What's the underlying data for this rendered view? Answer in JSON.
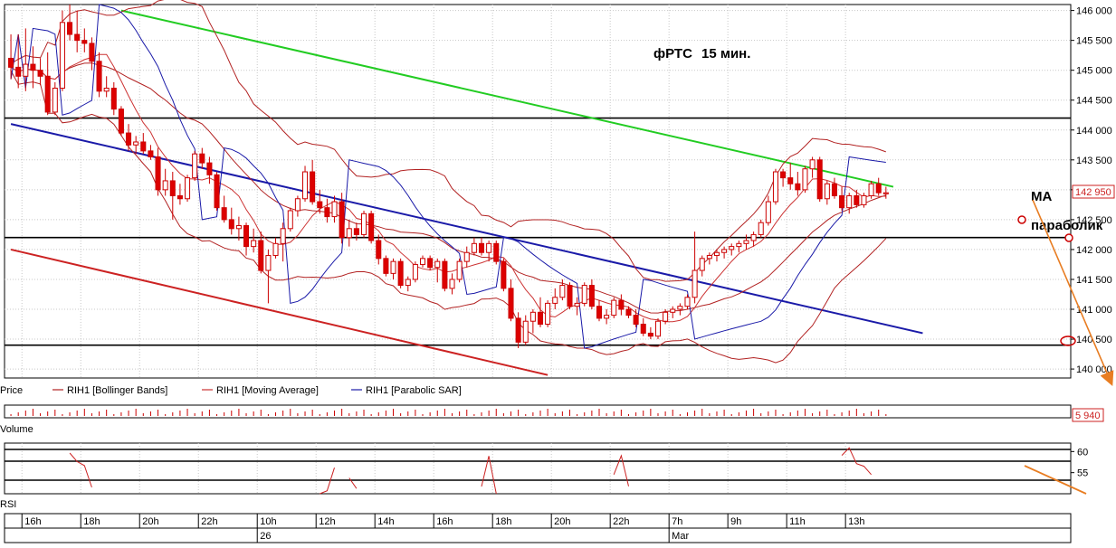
{
  "chart_data": {
    "type": "candlestick",
    "instrument": "RIH1",
    "title": "фРТС",
    "timeframe": "15 мин.",
    "price_axis": {
      "ylim": [
        139850,
        146100
      ],
      "ticks": [
        140000,
        140500,
        141000,
        141500,
        142000,
        142500,
        143000,
        143500,
        144000,
        144500,
        145000,
        145500,
        146000
      ],
      "tick_labels": [
        "140 000",
        "140 500",
        "141 000",
        "141 500",
        "142 000",
        "142 500",
        "143 000",
        "143 500",
        "144 000",
        "144 500",
        "145 000",
        "145 500",
        "146 000"
      ],
      "last_price_label": "142 950"
    },
    "time_axis": {
      "labels": [
        "16h",
        "18h",
        "20h",
        "22h",
        "10h",
        "12h",
        "14h",
        "16h",
        "18h",
        "20h",
        "22h",
        "7h",
        "9h",
        "11h",
        "13h"
      ],
      "label_bar_index": [
        2,
        10,
        18,
        26,
        34,
        42,
        50,
        58,
        66,
        74,
        82,
        90,
        98,
        106,
        114
      ],
      "dates": [
        {
          "label": "26",
          "bar_index": 34
        },
        {
          "label": "Mar",
          "bar_index": 90
        }
      ]
    },
    "legend": [
      "Price",
      "RIH1 [Bollinger Bands]",
      "RIH1 [Moving Average]",
      "RIH1 [Parabolic SAR]"
    ],
    "panels": {
      "volume": {
        "label": "Volume",
        "last_value_label": "5 940"
      },
      "rsi": {
        "label": "RSI",
        "ticks": [
          60,
          55
        ],
        "tick_labels": [
          "60",
          "55"
        ],
        "ylim": [
          50,
          62
        ]
      }
    },
    "horizontal_levels": [
      144200,
      142200,
      140400
    ],
    "trend_lines": [
      {
        "name": "green",
        "color": "#22cc22",
        "points": [
          [
            15,
            146000
          ],
          [
            120,
            143050
          ]
        ]
      },
      {
        "name": "blue",
        "color": "#1a1aa8",
        "points": [
          [
            0,
            144100
          ],
          [
            124,
            140600
          ]
        ]
      },
      {
        "name": "red",
        "color": "#cc2222",
        "points": [
          [
            0,
            142000
          ],
          [
            73,
            139900
          ]
        ]
      }
    ],
    "annotations": {
      "ma": "MA",
      "parabolic": "параболик"
    },
    "bars_ohlc": [
      [
        145200,
        145600,
        144850,
        145050
      ],
      [
        145050,
        145600,
        144700,
        144900
      ],
      [
        144900,
        145700,
        144650,
        145100
      ],
      [
        145100,
        145400,
        144700,
        145000
      ],
      [
        145000,
        145200,
        144750,
        144900
      ],
      [
        144900,
        145300,
        144250,
        144300
      ],
      [
        144300,
        144800,
        144250,
        144700
      ],
      [
        144700,
        146000,
        144650,
        145800
      ],
      [
        145800,
        146100,
        145500,
        145600
      ],
      [
        145600,
        146000,
        145300,
        145500
      ],
      [
        145500,
        145700,
        145300,
        145450
      ],
      [
        145450,
        145550,
        145000,
        145150
      ],
      [
        145150,
        145300,
        144550,
        144650
      ],
      [
        144650,
        144900,
        144550,
        144700
      ],
      [
        144700,
        144800,
        144250,
        144350
      ],
      [
        144350,
        144400,
        143900,
        143950
      ],
      [
        143950,
        144100,
        143650,
        143750
      ],
      [
        143750,
        143900,
        143600,
        143800
      ],
      [
        143800,
        143950,
        143600,
        143650
      ],
      [
        143650,
        143750,
        143500,
        143550
      ],
      [
        143550,
        143700,
        142900,
        143000
      ],
      [
        143000,
        143350,
        142900,
        143150
      ],
      [
        143150,
        143300,
        142500,
        142900
      ],
      [
        142900,
        143100,
        142750,
        142850
      ],
      [
        142850,
        143250,
        142800,
        143200
      ],
      [
        143200,
        143650,
        143150,
        143600
      ],
      [
        143600,
        143700,
        143350,
        143450
      ],
      [
        143450,
        143550,
        143100,
        143250
      ],
      [
        143250,
        143300,
        142650,
        142700
      ],
      [
        142700,
        142900,
        142450,
        142500
      ],
      [
        142500,
        142700,
        142250,
        142350
      ],
      [
        142350,
        142550,
        142150,
        142400
      ],
      [
        142400,
        142450,
        141900,
        142050
      ],
      [
        142050,
        142350,
        141950,
        142150
      ],
      [
        142150,
        142300,
        141600,
        141650
      ],
      [
        141650,
        142000,
        141100,
        141900
      ],
      [
        141900,
        142200,
        141850,
        142100
      ],
      [
        142100,
        142450,
        141800,
        142350
      ],
      [
        142350,
        142700,
        142300,
        142650
      ],
      [
        142650,
        142900,
        142550,
        142850
      ],
      [
        142850,
        143400,
        142800,
        143300
      ],
      [
        143300,
        143500,
        142750,
        142800
      ],
      [
        142800,
        143000,
        142600,
        142700
      ],
      [
        142700,
        142850,
        142450,
        142550
      ],
      [
        142550,
        142900,
        142450,
        142800
      ],
      [
        142800,
        142950,
        142100,
        142200
      ],
      [
        142200,
        142500,
        142050,
        142350
      ],
      [
        142350,
        142450,
        142150,
        142250
      ],
      [
        142250,
        142650,
        142200,
        142600
      ],
      [
        142600,
        142650,
        142100,
        142150
      ],
      [
        142150,
        142250,
        141750,
        141850
      ],
      [
        141850,
        141900,
        141550,
        141600
      ],
      [
        141600,
        141850,
        141500,
        141800
      ],
      [
        141800,
        141850,
        141350,
        141400
      ],
      [
        141400,
        141550,
        141300,
        141500
      ],
      [
        141500,
        141800,
        141450,
        141750
      ],
      [
        141750,
        141900,
        141700,
        141850
      ],
      [
        141850,
        141900,
        141650,
        141700
      ],
      [
        141700,
        141850,
        141450,
        141800
      ],
      [
        141800,
        141850,
        141300,
        141350
      ],
      [
        141350,
        141600,
        141250,
        141500
      ],
      [
        141500,
        141850,
        141450,
        141800
      ],
      [
        141800,
        142050,
        141700,
        141950
      ],
      [
        141950,
        142200,
        141900,
        142100
      ],
      [
        142100,
        142200,
        141900,
        141950
      ],
      [
        141950,
        142150,
        141800,
        142100
      ],
      [
        142100,
        142150,
        141750,
        141800
      ],
      [
        141800,
        141850,
        141300,
        141350
      ],
      [
        141350,
        141500,
        140800,
        140850
      ],
      [
        140850,
        140950,
        140350,
        140450
      ],
      [
        140450,
        140900,
        140400,
        140800
      ],
      [
        140800,
        141000,
        140600,
        140950
      ],
      [
        140950,
        141200,
        140700,
        140750
      ],
      [
        140750,
        141150,
        140700,
        141100
      ],
      [
        141100,
        141350,
        141000,
        141200
      ],
      [
        141200,
        141500,
        141150,
        141400
      ],
      [
        141400,
        141450,
        141000,
        141050
      ],
      [
        141050,
        141200,
        140900,
        141100
      ],
      [
        141100,
        141450,
        141050,
        141400
      ],
      [
        141400,
        141500,
        141000,
        141050
      ],
      [
        141050,
        141150,
        140800,
        140850
      ],
      [
        140850,
        141000,
        140750,
        140900
      ],
      [
        140900,
        141200,
        140850,
        141150
      ],
      [
        141150,
        141250,
        140900,
        141000
      ],
      [
        141000,
        141050,
        140850,
        140900
      ],
      [
        140900,
        141000,
        140700,
        140750
      ],
      [
        140750,
        140850,
        140550,
        140600
      ],
      [
        140600,
        140700,
        140500,
        140550
      ],
      [
        140550,
        140850,
        140500,
        140800
      ],
      [
        140800,
        141000,
        140750,
        140950
      ],
      [
        140950,
        141050,
        140850,
        141000
      ],
      [
        141000,
        141100,
        140900,
        141050
      ],
      [
        141050,
        141250,
        141000,
        141200
      ],
      [
        141200,
        142300,
        141100,
        141650
      ],
      [
        141650,
        141900,
        141550,
        141850
      ],
      [
        141850,
        141950,
        141750,
        141900
      ],
      [
        141900,
        142000,
        141800,
        141950
      ],
      [
        141950,
        142050,
        141850,
        142000
      ],
      [
        142000,
        142100,
        141900,
        142050
      ],
      [
        142050,
        142150,
        141950,
        142100
      ],
      [
        142100,
        142250,
        142000,
        142150
      ],
      [
        142150,
        142300,
        142050,
        142250
      ],
      [
        142250,
        142500,
        142200,
        142450
      ],
      [
        142450,
        142900,
        142400,
        142800
      ],
      [
        142800,
        143350,
        142750,
        143300
      ],
      [
        143300,
        143350,
        143050,
        143200
      ],
      [
        143200,
        143450,
        143000,
        143100
      ],
      [
        143100,
        143300,
        142900,
        143000
      ],
      [
        143000,
        143400,
        142950,
        143350
      ],
      [
        143350,
        143550,
        143200,
        143500
      ],
      [
        143500,
        143550,
        142800,
        142850
      ],
      [
        142850,
        143150,
        142750,
        143100
      ],
      [
        143100,
        143200,
        142850,
        142900
      ],
      [
        142900,
        143050,
        142650,
        142700
      ],
      [
        142700,
        142950,
        142600,
        142900
      ],
      [
        142900,
        143000,
        142700,
        142750
      ],
      [
        142750,
        142950,
        142700,
        142900
      ],
      [
        142900,
        143150,
        142850,
        143100
      ],
      [
        143100,
        143200,
        142900,
        142950
      ],
      [
        142950,
        143050,
        142850,
        142950
      ]
    ]
  }
}
